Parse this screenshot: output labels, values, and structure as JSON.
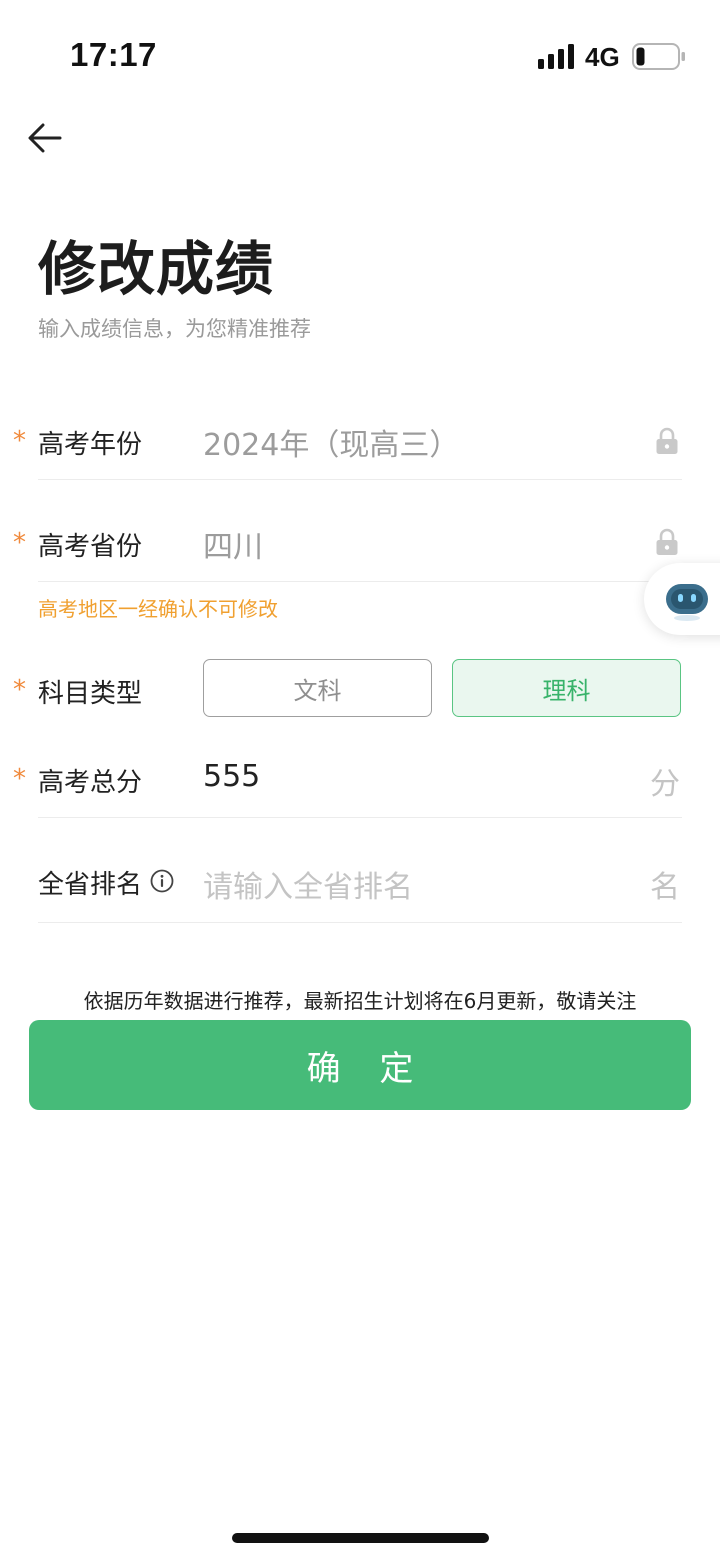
{
  "status_bar": {
    "time": "17:17",
    "network": "4G"
  },
  "header": {
    "title": "修改成绩",
    "subtitle": "输入成绩信息，为您精准推荐"
  },
  "form": {
    "required_mark": "*",
    "year": {
      "label": "高考年份",
      "value": "2024年（现高三）"
    },
    "province": {
      "label": "高考省份",
      "value": "四川",
      "hint": "高考地区一经确认不可修改"
    },
    "subject": {
      "label": "科目类型",
      "options": [
        "文科",
        "理科"
      ],
      "selected": "理科"
    },
    "score": {
      "label": "高考总分",
      "value": "555",
      "unit": "分"
    },
    "rank": {
      "label": "全省排名",
      "placeholder": "请输入全省排名",
      "unit": "名"
    }
  },
  "notice": "依据历年数据进行推荐，最新招生计划将在6月更新，敬请关注",
  "confirm_label": "确 定",
  "colors": {
    "accent": "#46bb79",
    "warning": "#f0a030",
    "required": "#f08a3c"
  }
}
